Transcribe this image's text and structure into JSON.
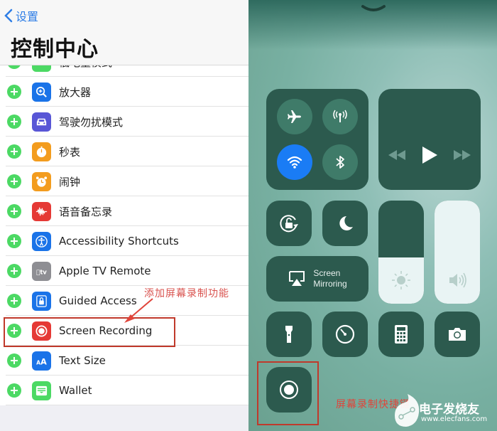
{
  "left": {
    "back_label": "设置",
    "title": "控制中心",
    "items": [
      {
        "label": "低电量模式",
        "icon": "battery-icon",
        "color": "#4cd964"
      },
      {
        "label": "放大器",
        "icon": "magnifier-icon",
        "color": "#1a73e8"
      },
      {
        "label": "驾驶勿扰模式",
        "icon": "car-icon",
        "color": "#5856d6"
      },
      {
        "label": "秒表",
        "icon": "stopwatch-icon",
        "color": "#f39c1e"
      },
      {
        "label": "闹钟",
        "icon": "alarm-icon",
        "color": "#f39c1e"
      },
      {
        "label": "语音备忘录",
        "icon": "voice-memo-icon",
        "color": "#e53935"
      },
      {
        "label": "Accessibility Shortcuts",
        "icon": "accessibility-icon",
        "color": "#1a73e8"
      },
      {
        "label": "Apple TV Remote",
        "icon": "apple-tv-icon",
        "color": "#8e8e93"
      },
      {
        "label": "Guided Access",
        "icon": "lock-icon",
        "color": "#1a73e8"
      },
      {
        "label": "Screen Recording",
        "icon": "screen-record-icon",
        "color": "#e53935"
      },
      {
        "label": "Text Size",
        "icon": "text-size-icon",
        "color": "#1a73e8"
      },
      {
        "label": "Wallet",
        "icon": "wallet-icon",
        "color": "#4cd964"
      }
    ],
    "annotation": "添加屏幕录制功能",
    "text_size_glyph": "AA",
    "apple_tv_glyph": "tv"
  },
  "right": {
    "connectivity": {
      "airplane_mode": false,
      "cellular_data": false,
      "wifi": true,
      "bluetooth": false
    },
    "media": {
      "rewind": "rewind-icon",
      "play": "play-icon",
      "forward": "fast-forward-icon"
    },
    "screen_mirroring_label_1": "Screen",
    "screen_mirroring_label_2": "Mirroring",
    "brightness_level": 0.45,
    "volume_level": 1.0,
    "annotation": "屏幕录制快捷键",
    "watermark_title": "电子发烧友",
    "watermark_url": "www.elecfans.com",
    "colors": {
      "tile": "#2c5a4e",
      "active_wifi": "#1a7cf5",
      "annotation": "#e0443a"
    }
  }
}
